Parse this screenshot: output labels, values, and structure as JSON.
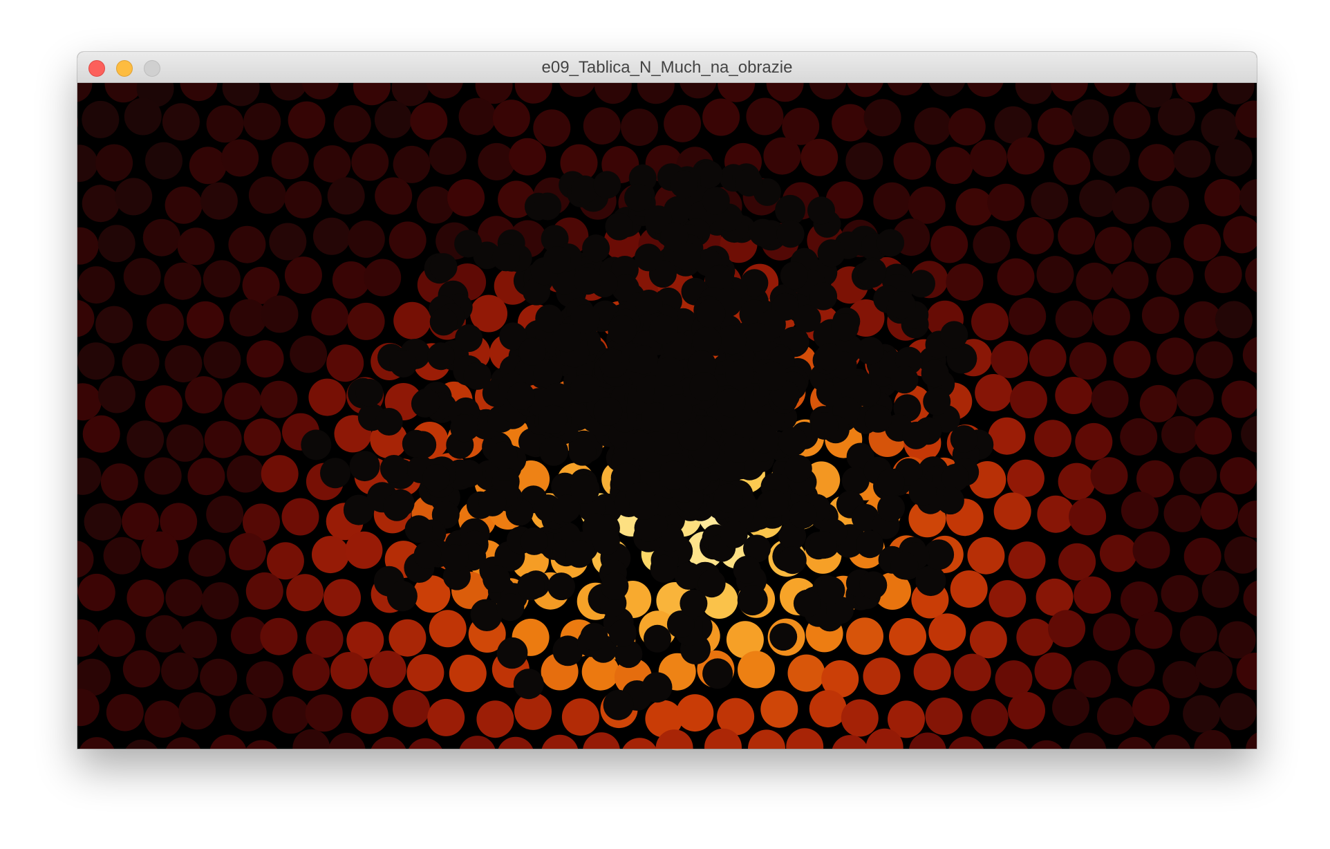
{
  "window": {
    "title": "e09_Tablica_N_Much_na_obrazie",
    "controls": {
      "close": "close-icon",
      "minimize": "minimize-icon",
      "zoom": "zoom-icon"
    }
  },
  "sketch": {
    "description_type": "processing-sketch-output",
    "background_color": "#000000",
    "fly_color": "#0b0807",
    "palette": [
      "#140606",
      "#3a0505",
      "#6a0c05",
      "#9a1c06",
      "#c83a06",
      "#ec7a10",
      "#f7a52a",
      "#fcd35c",
      "#fff2b8"
    ]
  }
}
